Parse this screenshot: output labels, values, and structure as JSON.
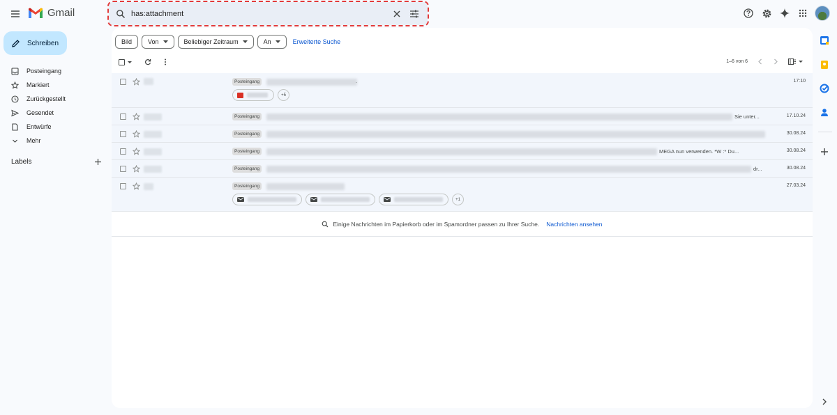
{
  "header": {
    "app_name": "Gmail",
    "search_value": "has:attachment",
    "icons": [
      "menu-icon",
      "search-icon",
      "close-icon",
      "tune-icon",
      "help-icon",
      "gear-icon",
      "gemini-icon",
      "apps-grid-icon"
    ]
  },
  "compose": {
    "label": "Schreiben"
  },
  "nav": {
    "items": [
      {
        "label": "Posteingang",
        "icon": "inbox-icon"
      },
      {
        "label": "Markiert",
        "icon": "star-icon"
      },
      {
        "label": "Zurückgestellt",
        "icon": "clock-icon"
      },
      {
        "label": "Gesendet",
        "icon": "send-icon"
      },
      {
        "label": "Entwürfe",
        "icon": "draft-icon"
      },
      {
        "label": "Mehr",
        "icon": "chevron-down-icon"
      }
    ],
    "labels_heading": "Labels"
  },
  "filters": {
    "chips": [
      {
        "label": "Bild",
        "dropdown": false
      },
      {
        "label": "Von",
        "dropdown": true
      },
      {
        "label": "Beliebiger Zeitraum",
        "dropdown": true
      },
      {
        "label": "An",
        "dropdown": true
      }
    ],
    "advanced": "Erweiterte Suche"
  },
  "pagination": {
    "range": "1–6 von 6"
  },
  "emails": [
    {
      "tag": "Posteingang",
      "tail": ".",
      "date": "17:10",
      "more": "+5"
    },
    {
      "tag": "Posteingang",
      "tail": "Sie unter...",
      "date": "17.10.24"
    },
    {
      "tag": "Posteingang",
      "tail": "",
      "date": "30.08.24"
    },
    {
      "tag": "Posteingang",
      "tail": "MEGA nun verwenden. *W      :* Du...",
      "date": "30.08.24"
    },
    {
      "tag": "Posteingang",
      "tail": "dr...",
      "date": "30.08.24"
    },
    {
      "tag": "Posteingang",
      "tail": "",
      "date": "27.03.24",
      "more": "+1"
    }
  ],
  "notice": {
    "text": "Einige Nachrichten im Papierkorb oder im Spamordner passen zu Ihrer Suche.",
    "link": "Nachrichten ansehen"
  },
  "colors": {
    "accent": "#0b57d0",
    "compose_bg": "#c2e7ff",
    "search_outline": "#e23b3b"
  }
}
